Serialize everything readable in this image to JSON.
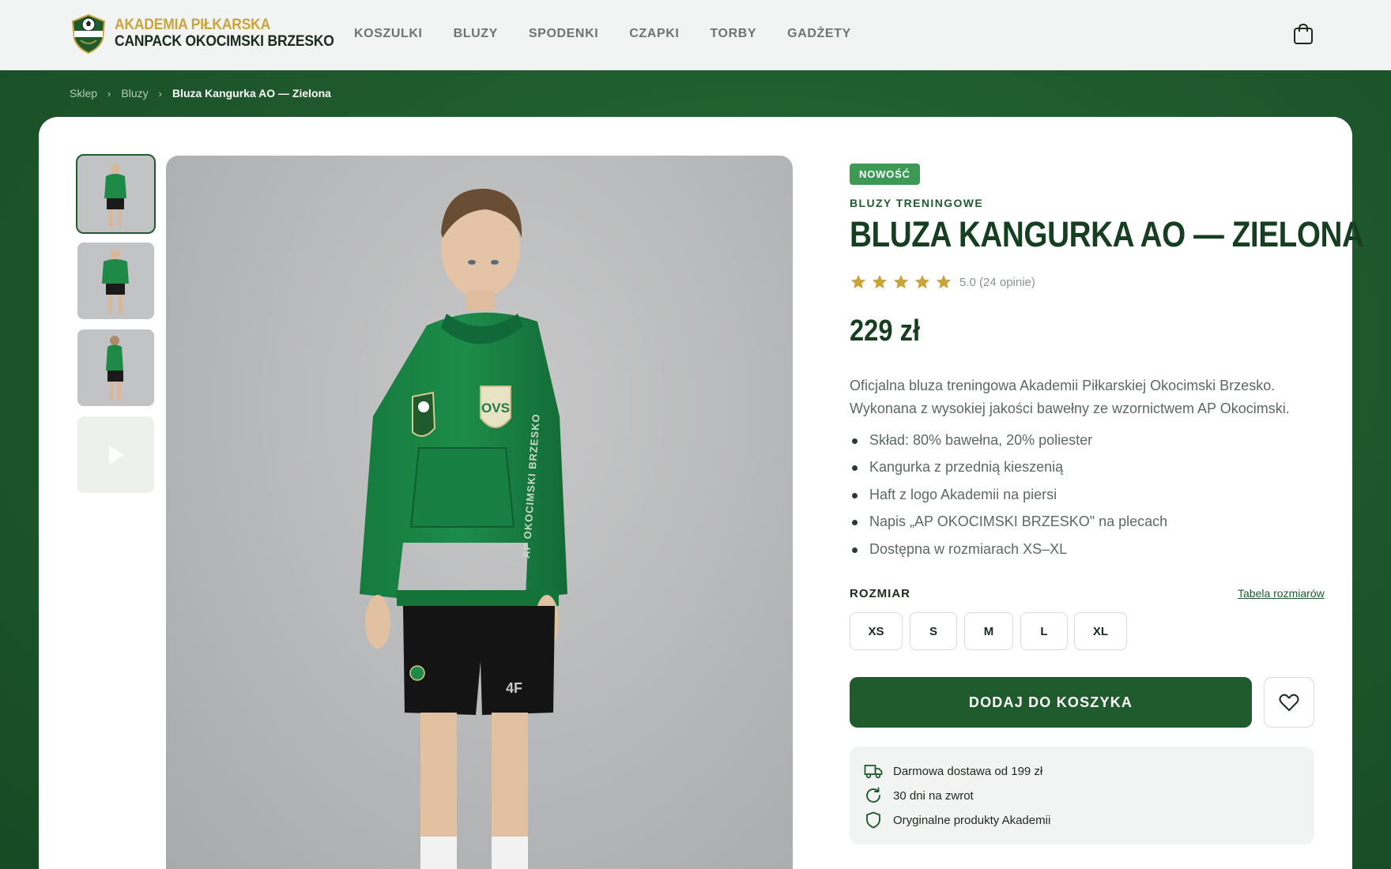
{
  "header": {
    "brand_line1": "AKADEMIA PIŁKARSKA",
    "brand_line2": "CANPACK OKOCIMSKI BRZESKO",
    "logo_icon": "academy-crest-icon",
    "nav": [
      {
        "label": "KOSZULKI"
      },
      {
        "label": "BLUZY"
      },
      {
        "label": "SPODENKI"
      },
      {
        "label": "CZAPKI"
      },
      {
        "label": "TORBY"
      },
      {
        "label": "GADŻETY"
      }
    ],
    "cart_icon": "shopping-bag-icon"
  },
  "breadcrumb": {
    "items": [
      "Sklep",
      "Bluzy"
    ],
    "current": "Bluza Kangurka AO — Zielona"
  },
  "gallery": {
    "thumbnails": 4,
    "active_index": 0,
    "video_icon": "play-icon"
  },
  "product": {
    "badge": "NOWOŚĆ",
    "category": "BLUZY TRENINGOWE",
    "title": "BLUZA KANGURKA AO — ZIELONA",
    "rating_value": 5.0,
    "rating_text": "5.0 (24 opinie)",
    "price": "229 zł",
    "description": "Oficjalna bluza treningowa Akademii Piłkarskiej Okocimski Brzesko. Wykonana z wysokiej jakości bawełny ze wzornictwem AP Okocimski.",
    "features": [
      "Skład: 80% bawełna, 20% poliester",
      "Kangurka z przednią kieszenią",
      "Haft z logo Akademii na piersi",
      "Napis „AP OKOCIMSKI BRZESKO\" na plecach",
      "Dostępna w rozmiarach XS–XL"
    ],
    "size_label": "ROZMIAR",
    "size_table_link": "Tabela rozmiarów",
    "sizes": [
      "XS",
      "S",
      "M",
      "L",
      "XL"
    ],
    "add_to_cart": "DODAJ DO KOSZYKA",
    "wishlist_icon": "heart-icon"
  },
  "perks": [
    {
      "icon": "truck-icon",
      "text": "Darmowa dostawa od 199 zł"
    },
    {
      "icon": "return-arrow-icon",
      "text": "30 dni na zwrot"
    },
    {
      "icon": "shield-icon",
      "text": "Oryginalne produkty Akademii"
    }
  ],
  "colors": {
    "brand_green": "#1f5b2d",
    "gold": "#c9a43a",
    "badge_green": "#3c9a55",
    "star": "#c9a43a"
  }
}
